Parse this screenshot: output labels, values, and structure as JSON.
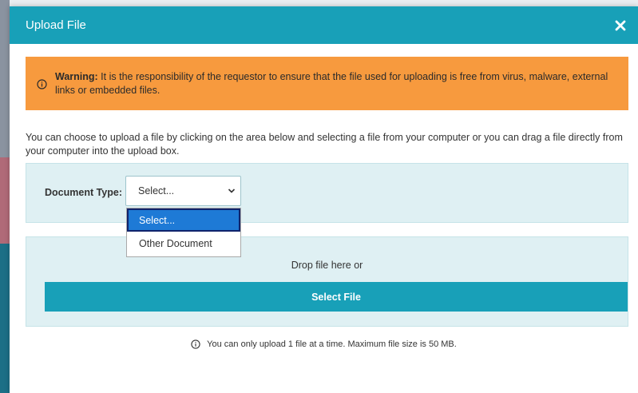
{
  "modal": {
    "title": "Upload File"
  },
  "icons": {
    "close": "close-icon",
    "warning": "info-circle-icon",
    "select": "chevron-down-icon",
    "limit_note": "info-circle-icon"
  },
  "warning": {
    "label": "Warning:",
    "text": " It is the responsibility of the requestor to ensure that the file used for uploading is free from virus, malware, external links or embedded files."
  },
  "intro_text": "You can choose to upload a file by clicking on the area below and selecting a file from your computer or you can drag a file directly from your computer into the upload box.",
  "document_type": {
    "label": "Document Type:",
    "selected": "Select...",
    "options": [
      "Select...",
      "Other Document"
    ]
  },
  "dropzone": {
    "text": "Drop file here or",
    "button_label": "Select File"
  },
  "limit_note": "You can only upload 1 file at a time. Maximum file size is 50 MB.",
  "colors": {
    "header": "#18a0b8",
    "warning": "#f79a3e",
    "panel": "#dff0f3",
    "option_highlight": "#1e7ad6"
  }
}
